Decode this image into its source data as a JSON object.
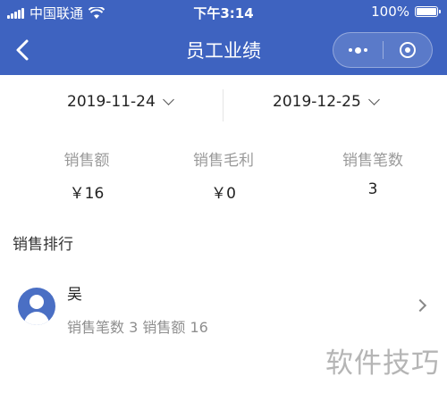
{
  "status_bar": {
    "carrier": "中国联通",
    "time": "下午3:14",
    "battery": "100%",
    "battery_level": 1.0
  },
  "nav": {
    "title": "员工业绩",
    "icons": {
      "back": "back-arrow-icon",
      "more": "more-dots-icon",
      "close": "close-target-icon"
    }
  },
  "dates": {
    "start": "2019-11-24",
    "end": "2019-12-25"
  },
  "stats": [
    {
      "label": "销售额",
      "value": "￥16"
    },
    {
      "label": "销售毛利",
      "value": "￥0"
    },
    {
      "label": "销售笔数",
      "value": "3"
    }
  ],
  "ranking": {
    "title": "销售排行",
    "items": [
      {
        "name": "吴",
        "summary": "销售笔数 3 销售额 16"
      }
    ]
  },
  "watermark": "软件技巧",
  "colors": {
    "header": "#3e63c0",
    "avatar": "#4a6fc4"
  }
}
